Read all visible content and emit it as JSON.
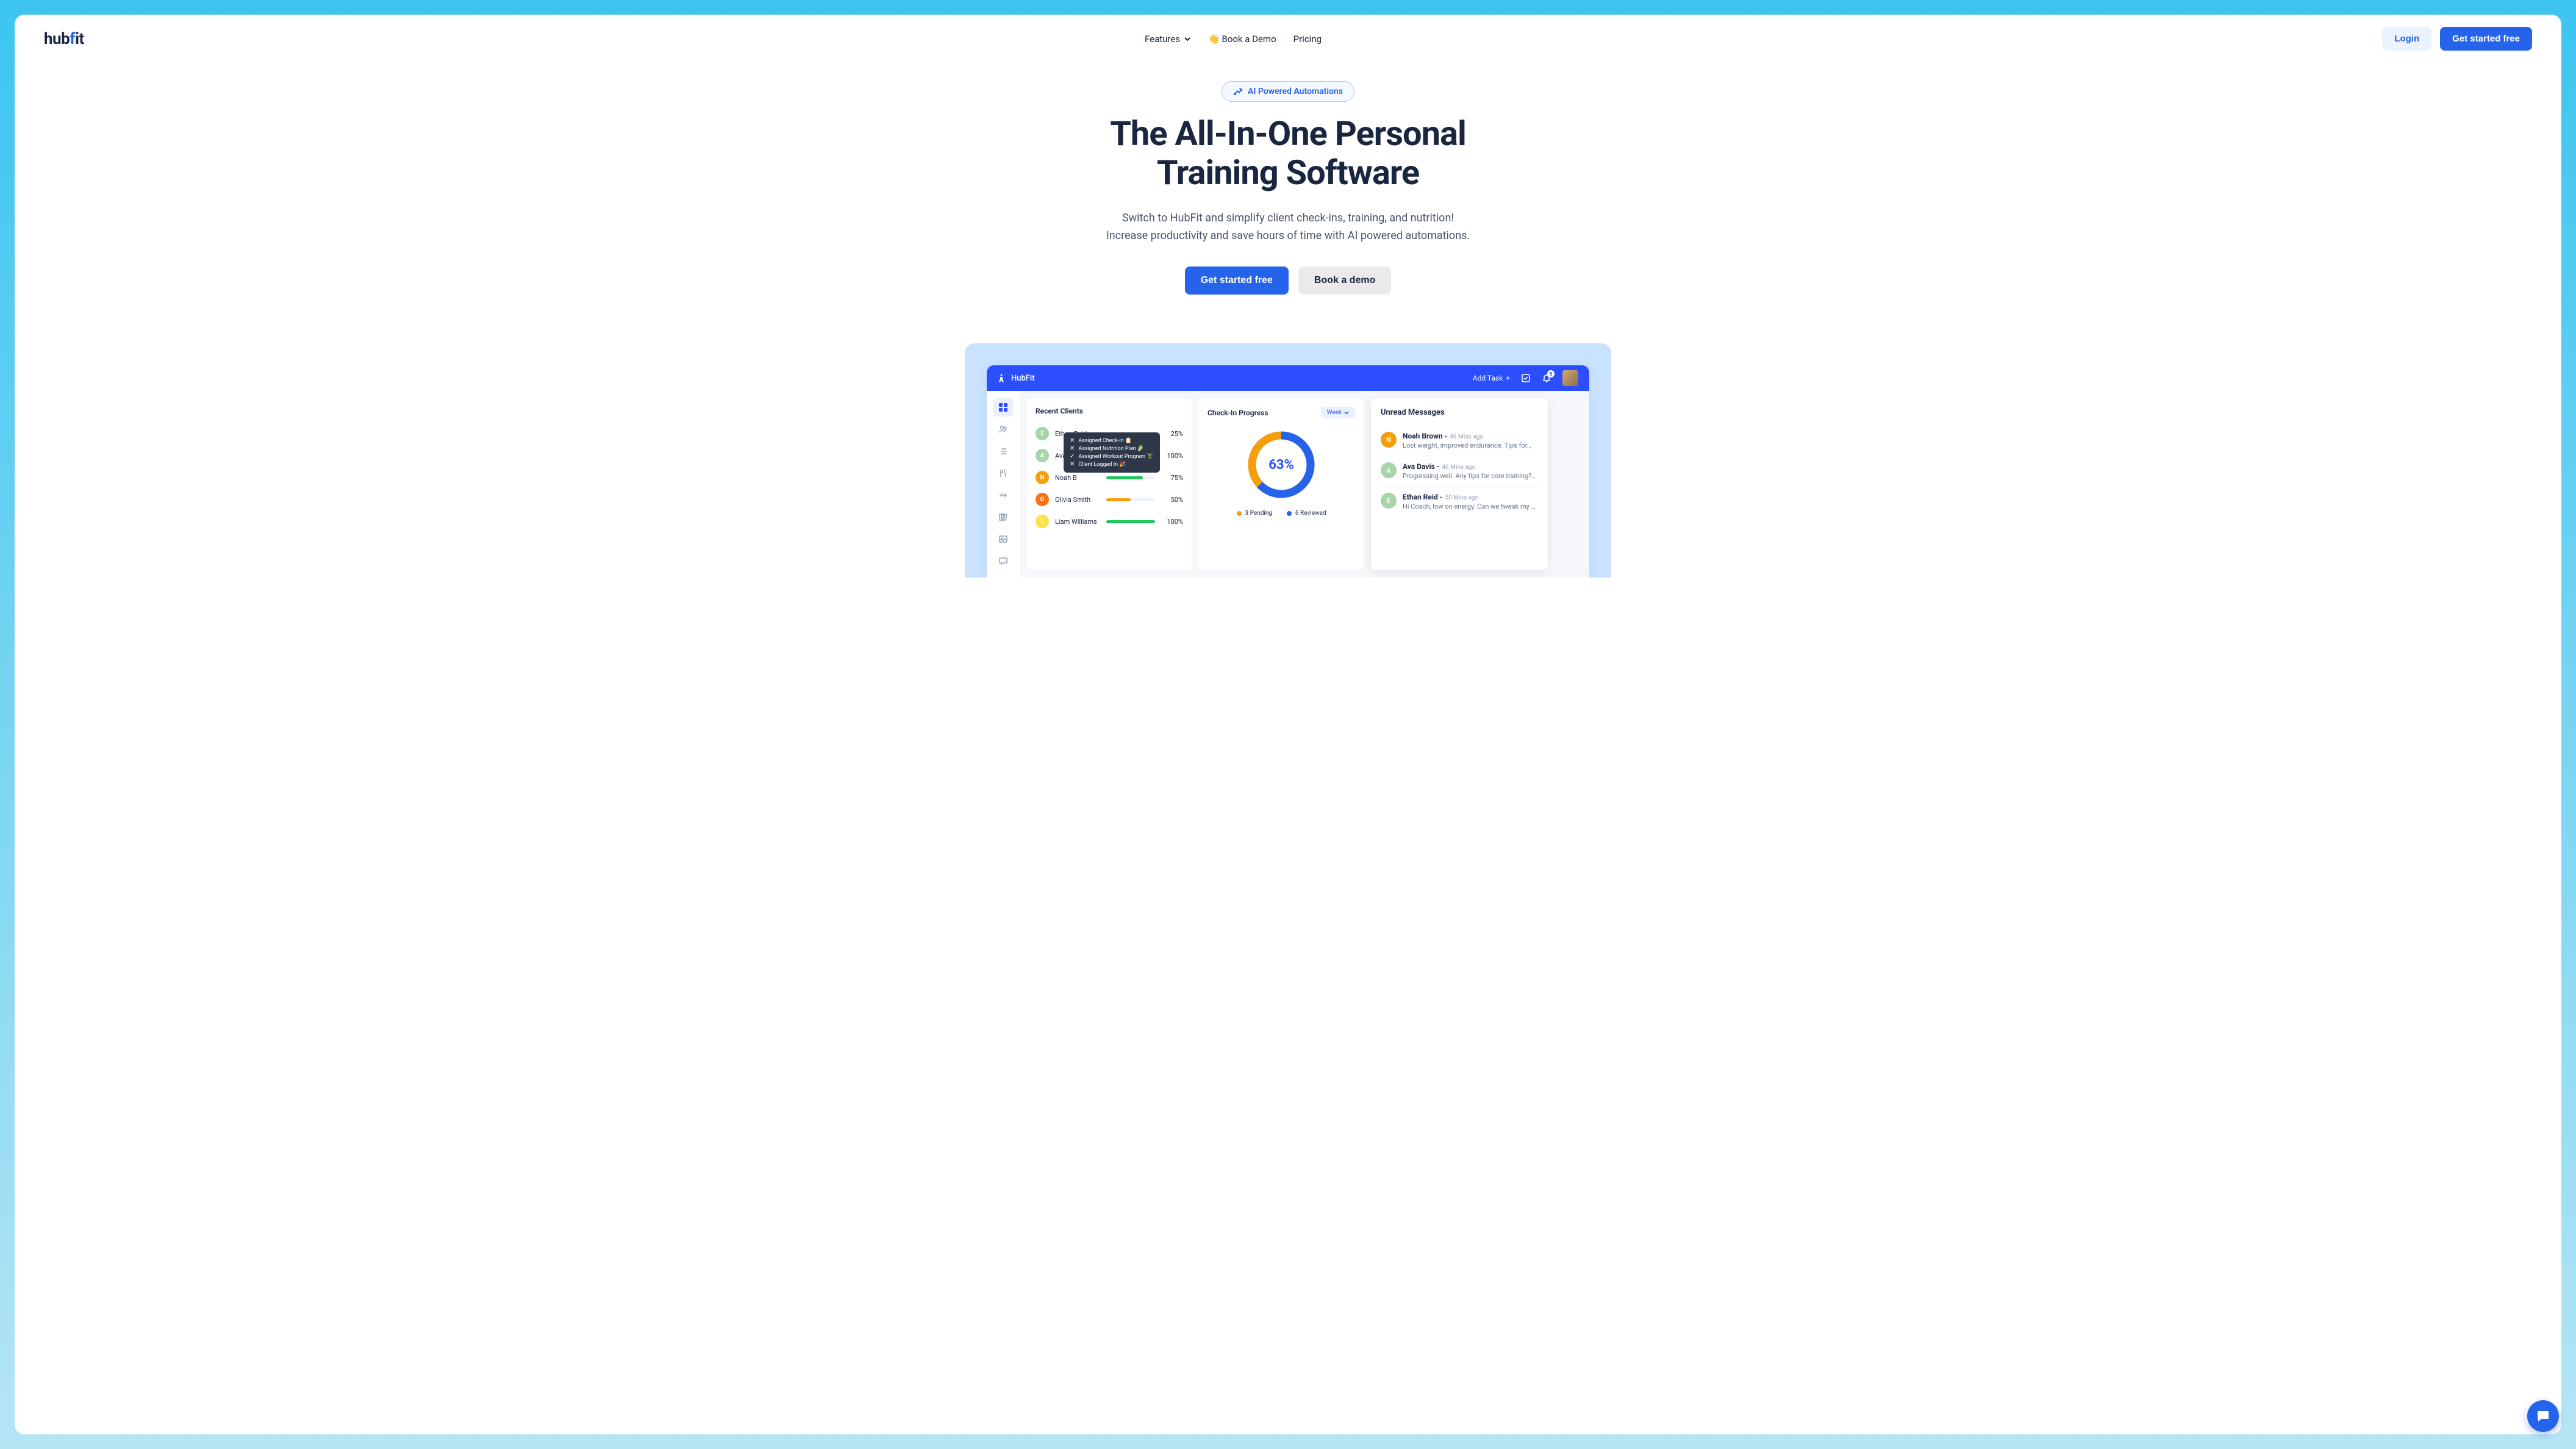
{
  "brand": {
    "name": "hubfit"
  },
  "nav": {
    "features": "Features",
    "book_demo": "👋  Book a Demo",
    "pricing": "Pricing"
  },
  "header_buttons": {
    "login": "Login",
    "get_started": "Get started free"
  },
  "hero": {
    "badge": "AI Powered Automations",
    "title_line1": "The All-In-One Personal",
    "title_line2": "Training Software",
    "subtitle_line1": "Switch to HubFit and simplify client check-ins, training, and nutrition!",
    "subtitle_line2": "Increase productivity and save hours of time with AI powered automations.",
    "cta_primary": "Get started free",
    "cta_secondary": "Book a demo"
  },
  "dashboard": {
    "brand": "HubFit",
    "add_task": "Add Task",
    "bell_count": "5",
    "recent_clients": {
      "title": "Recent Clients",
      "rows": [
        {
          "letter": "E",
          "color": "#a7d4a8",
          "name": "Ethan Reid",
          "pct": 25,
          "bar_color": "#f59e0b"
        },
        {
          "letter": "A",
          "color": "#a7d4a8",
          "name": "Ava Dav",
          "pct": 100,
          "bar_color": "#22c55e"
        },
        {
          "letter": "N",
          "color": "#f59e0b",
          "name": "Noah B",
          "pct": 75,
          "bar_color": "#22c55e"
        },
        {
          "letter": "O",
          "color": "#f97316",
          "name": "Olivia Smith",
          "pct": 50,
          "bar_color": "#f59e0b"
        },
        {
          "letter": "L",
          "color": "#fde047",
          "name": "Liam Williams",
          "pct": 100,
          "bar_color": "#22c55e"
        }
      ]
    },
    "tooltip": {
      "rows": [
        {
          "mark": "✕",
          "text": "Assigned Check-In 📋"
        },
        {
          "mark": "✕",
          "text": "Assigned Nutrition Plan 🥬"
        },
        {
          "mark": "✓",
          "text": "Assigned Workout Program 🏋"
        },
        {
          "mark": "✕",
          "text": "Client Logged In 🎉"
        }
      ]
    },
    "checkin": {
      "title": "Check-In Progress",
      "period": "Week",
      "pct": "63%",
      "pending_label": "3 Pending",
      "reviewed_label": "6 Reviewed",
      "pending_color": "#f59e0b",
      "reviewed_color": "#2563eb"
    },
    "messages": {
      "title": "Unread Messages",
      "rows": [
        {
          "letter": "N",
          "color": "#f59e0b",
          "name": "Noah Brown",
          "time": "46 Mins ago",
          "text": "Lost weight, improved endurance. Tips for…"
        },
        {
          "letter": "A",
          "color": "#a7d4a8",
          "name": "Ava Davis",
          "time": "48 Mins ago",
          "text": "Progressing well. Any tips for core training?…"
        },
        {
          "letter": "E",
          "color": "#a7d4a8",
          "name": "Ethan Reid",
          "time": "50 Mins ago",
          "text": "Hi Coach, low on energy. Can we tweak my meal…"
        }
      ]
    }
  }
}
